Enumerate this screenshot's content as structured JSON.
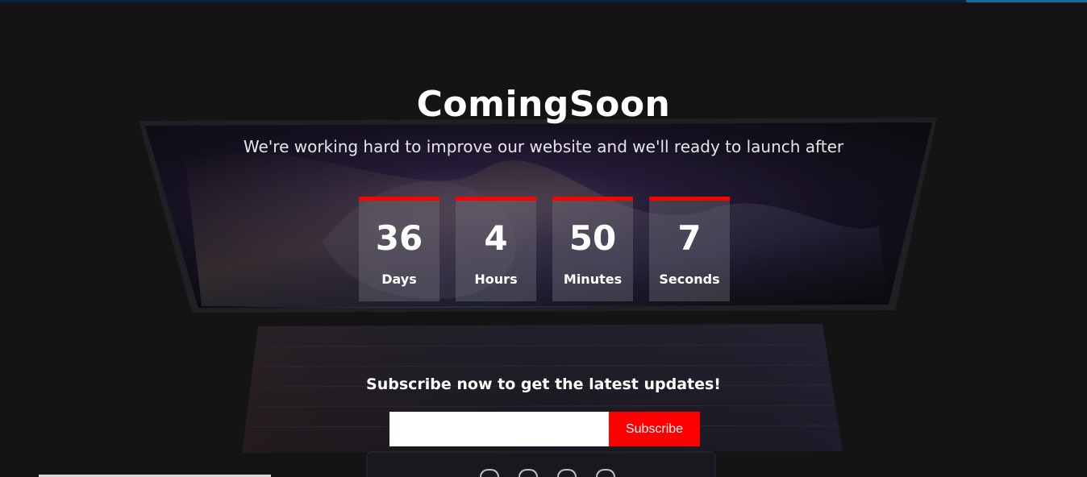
{
  "page": {
    "title": "ComingSoon",
    "subtitle": "We're working hard to improve our website and we'll ready to launch after"
  },
  "countdown": [
    {
      "value": "36",
      "label": "Days"
    },
    {
      "value": "4",
      "label": "Hours"
    },
    {
      "value": "50",
      "label": "Minutes"
    },
    {
      "value": "7",
      "label": "Seconds"
    }
  ],
  "subscribe": {
    "heading": "Subscribe now to get the latest updates!",
    "input_value": "",
    "button_label": "Subscribe"
  },
  "colors": {
    "accent": "#ff0000",
    "background": "#1b1b1d",
    "progress": "#1d8ad6"
  },
  "icons": [
    "social-icon-1",
    "social-icon-2",
    "social-icon-3",
    "social-icon-4"
  ]
}
